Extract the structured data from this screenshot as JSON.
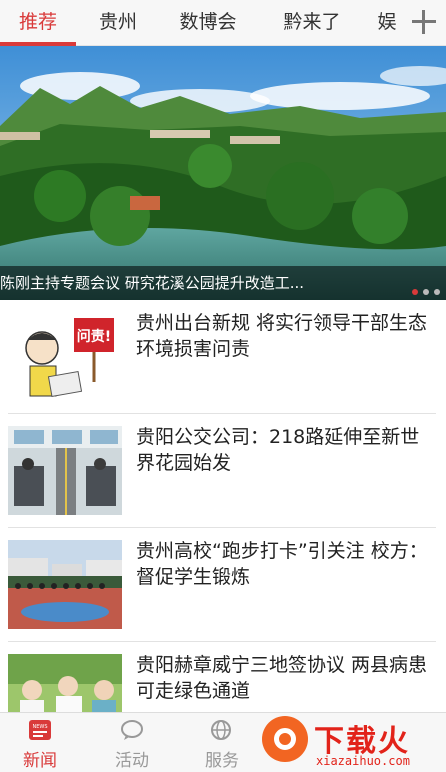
{
  "tabs": [
    {
      "label": "推荐",
      "active": true
    },
    {
      "label": "贵州",
      "active": false
    },
    {
      "label": "数博会",
      "active": false
    },
    {
      "label": "黔来了",
      "active": false
    },
    {
      "label": "娱",
      "active": false
    }
  ],
  "icons": {
    "add_tab": "plus-icon"
  },
  "hero": {
    "caption": "陈刚主持专题会议 研究花溪公园提升改造工...",
    "dots": 3,
    "active_dot": 0
  },
  "news": [
    {
      "title": "贵州出台新规 将实行领导干部生态环境损害问责",
      "thumb": "cartoon-accountability",
      "sign_text": "问责!"
    },
    {
      "title": "贵阳公交公司：218路延伸至新世界花园始发",
      "thumb": "bus-interior"
    },
    {
      "title": "贵州高校“跑步打卡”引关注 校方：督促学生锻炼",
      "thumb": "campus-run"
    },
    {
      "title": "贵阳赫章威宁三地签协议 两县病患可走绿色通道",
      "thumb": "medical-staff"
    }
  ],
  "bottom_nav": [
    {
      "label": "新闻",
      "icon": "news-icon",
      "badge": "NEWS",
      "active": true
    },
    {
      "label": "活动",
      "icon": "chat-icon",
      "active": false
    },
    {
      "label": "服务",
      "icon": "globe-icon",
      "active": false
    }
  ],
  "watermark": {
    "name": "下载火",
    "url": "xiazaihuo.com"
  },
  "colors": {
    "accent": "#d93a3a",
    "logo": "#e2231a"
  }
}
